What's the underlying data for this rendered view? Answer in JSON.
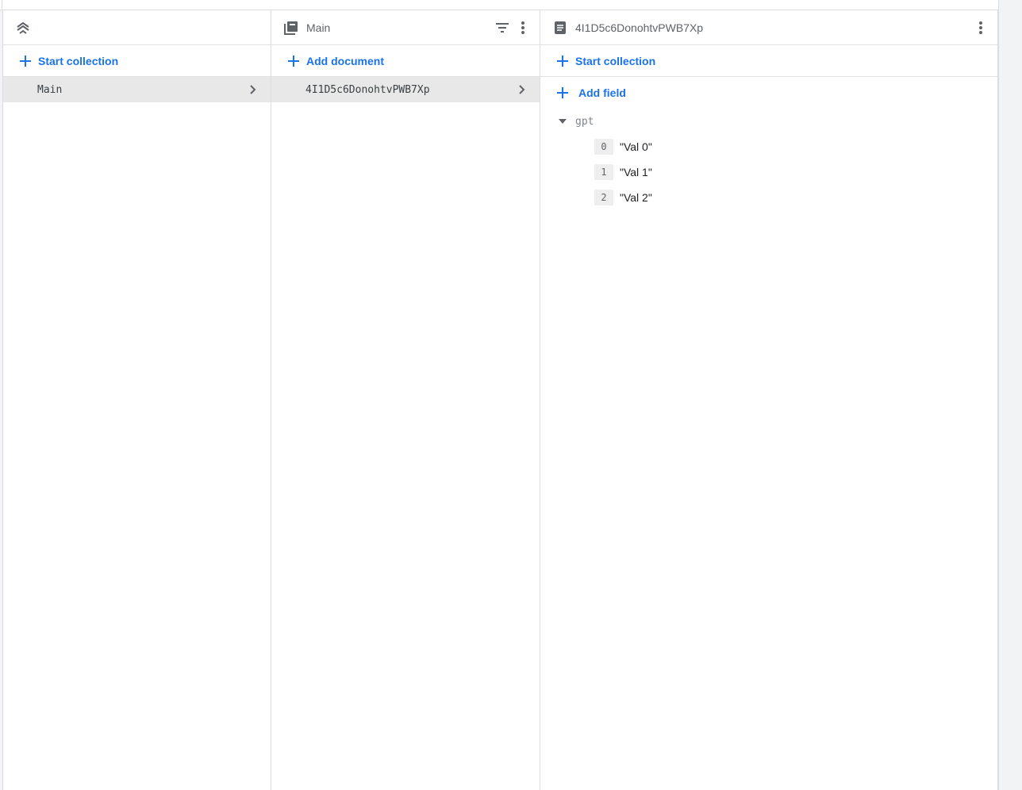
{
  "root": {
    "project_name": "",
    "start_collection_label": "Start collection",
    "items": [
      {
        "label": "Main"
      }
    ]
  },
  "collection": {
    "title": "Main",
    "add_document_label": "Add document",
    "items": [
      {
        "label": "4I1D5c6DonohtvPWB7Xp"
      }
    ]
  },
  "document": {
    "title": "4I1D5c6DonohtvPWB7Xp",
    "start_collection_label": "Start collection",
    "add_field_label": "Add field",
    "field": {
      "name": "gpt",
      "entries": [
        {
          "index": "0",
          "value": "\"Val 0\""
        },
        {
          "index": "1",
          "value": "\"Val 1\""
        },
        {
          "index": "2",
          "value": "\"Val 2\""
        }
      ]
    }
  },
  "colors": {
    "accent": "#1a73e8",
    "selected_row": "#e8e8e8",
    "divider": "#dadce0",
    "icon": "#5f6368"
  },
  "icons": {
    "root": "firestore-stack-icon",
    "collection": "collection-icon",
    "document": "document-icon",
    "filter": "filter-icon",
    "menu": "more-vert-icon",
    "add": "plus-icon",
    "chevron": "chevron-right-icon",
    "caret": "caret-down-icon"
  }
}
